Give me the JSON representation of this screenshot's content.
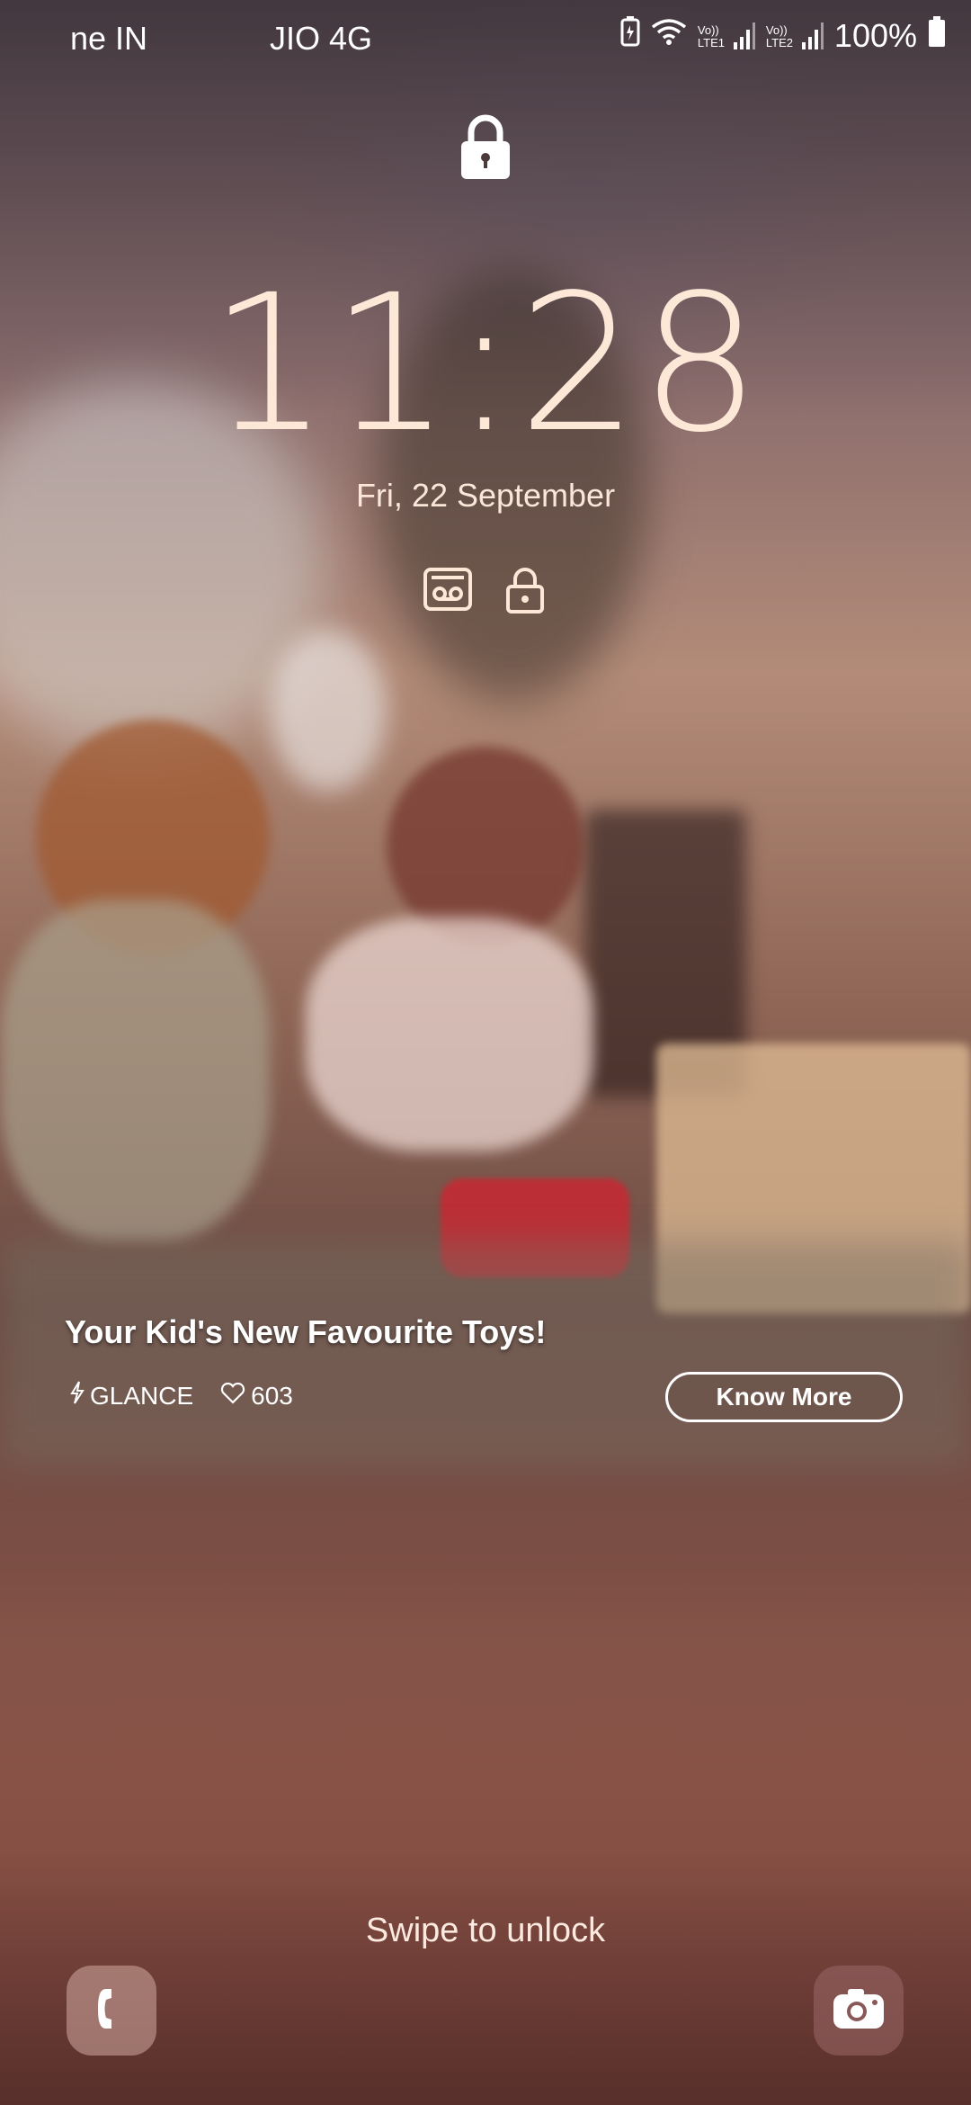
{
  "status_bar": {
    "left_text": "ne IN",
    "carrier": "JIO 4G",
    "battery_percent": "100%",
    "sim1_label": "Vo)) LTE1",
    "sim2_label": "Vo)) LTE2",
    "icons": [
      "battery-saver-icon",
      "wifi-icon",
      "signal-sim1-icon",
      "signal-sim2-icon",
      "battery-icon"
    ]
  },
  "lock_screen": {
    "time": "11:28",
    "date": "Fri, 22 September",
    "swipe_hint": "Swipe to unlock",
    "indicator_icons": [
      "voicemail-icon",
      "lock-icon"
    ]
  },
  "glance": {
    "title": "Your Kid's New Favourite Toys!",
    "source": "GLANCE",
    "likes": "603",
    "cta": "Know More"
  },
  "shortcuts": {
    "left": "phone-icon",
    "right": "camera-icon"
  },
  "colors": {
    "clock_text": "#fde8d8",
    "accent_white": "#ffffff"
  }
}
